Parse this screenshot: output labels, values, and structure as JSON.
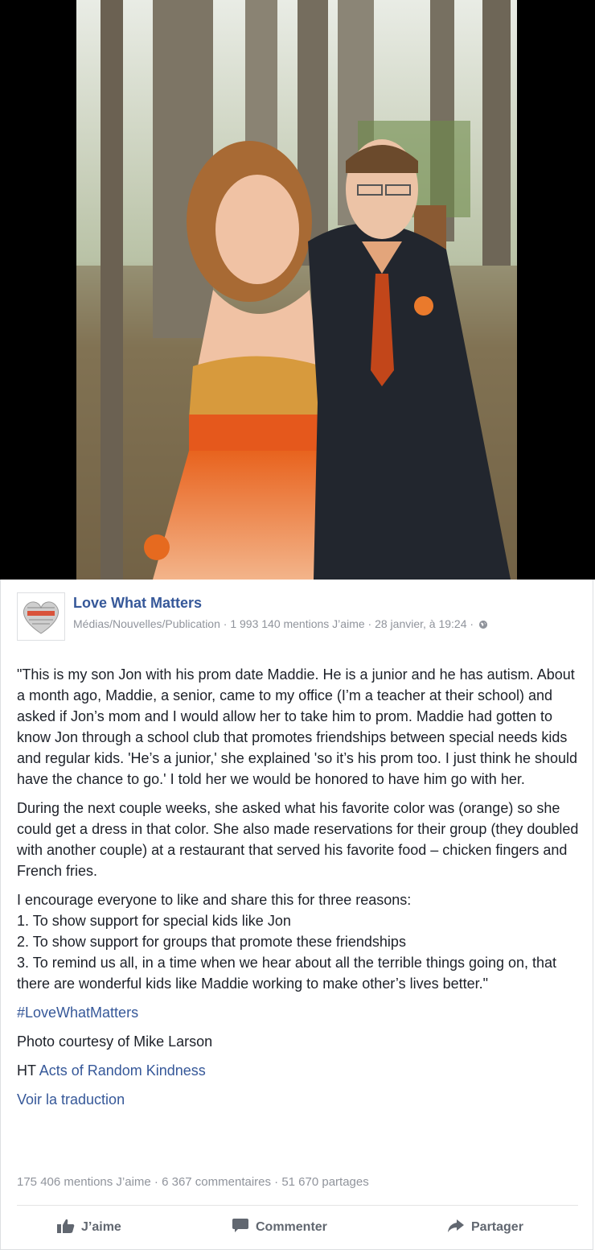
{
  "post": {
    "page_name": "Love What Matters",
    "meta_line": "Médias/Nouvelles/Publication · 1 993 140 mentions J’aime · 28 janvier, à 19:24 ·",
    "paragraphs": [
      "\"This is my son Jon with his prom date Maddie. He is a junior and he has autism. About a month ago, Maddie, a senior, came to my office (I’m a teacher at their school) and asked if Jon’s mom and I would allow her to take him to prom. Maddie had gotten to know Jon through a school club that promotes friendships between special needs kids and regular kids. 'He’s a junior,' she explained 'so it’s his prom too. I just think he should have the chance to go.' I told her we would be honored to have him go with her.",
      "During the next couple weeks, she asked what his favorite color was (orange) so she could get a dress in that color. She also made reservations for their group (they doubled with another couple) at a restaurant that served his favorite food – chicken fingers and French fries.",
      "I encourage everyone to like and share this for three reasons:\n1. To show support for special kids like Jon\n2. To show support for groups that promote these friendships\n3. To remind us all, in a time when we hear about all the terrible things going on, that there are wonderful kids like Maddie working to make other’s lives better.\""
    ],
    "hashtag": "#LoveWhatMatters",
    "photo_credit": "Photo courtesy of Mike Larson",
    "ht_prefix": "HT",
    "ht_link": "Acts of Random Kindness",
    "translate": "Voir la traduction",
    "stats": "175 406 mentions J’aime · 6 367 commentaires · 51 670 partages",
    "actions": {
      "like": "J’aime",
      "comment": "Commenter",
      "share": "Partager"
    }
  },
  "colors": {
    "link": "#365899",
    "muted": "#90949c",
    "text": "#1d2129",
    "action": "#616770"
  },
  "icons": {
    "avatar": "heart-logo-icon",
    "privacy": "globe-icon",
    "like": "thumbs-up-icon",
    "comment": "speech-bubble-icon",
    "share": "share-arrow-icon"
  }
}
